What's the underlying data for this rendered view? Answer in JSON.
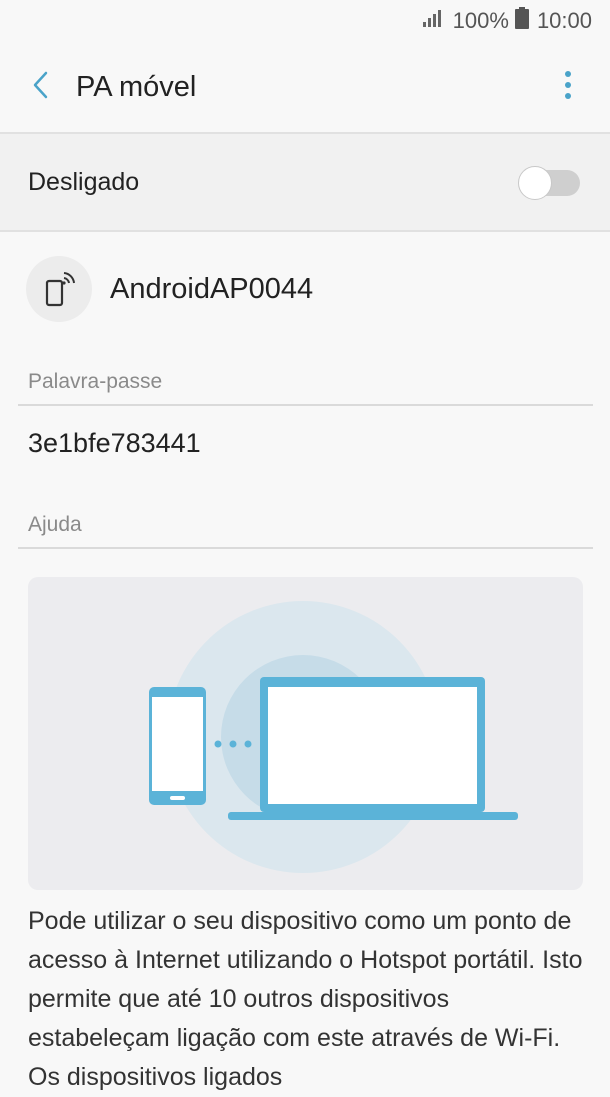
{
  "status_bar": {
    "battery": "100%",
    "time": "10:00",
    "signal_icon": "signal-bars-icon",
    "battery_icon": "battery-full-icon"
  },
  "app_bar": {
    "title": "PA móvel",
    "back_icon": "back-chevron-icon",
    "more_icon": "more-vertical-icon"
  },
  "toggle": {
    "label": "Desligado",
    "state": "off"
  },
  "network": {
    "name": "AndroidAP0044",
    "icon": "phone-hotspot-icon"
  },
  "password": {
    "header": "Palavra-passe",
    "value": "3e1bfe783441"
  },
  "help": {
    "header": "Ajuda",
    "text": "Pode utilizar o seu dispositivo como um ponto de acesso à Internet utilizando o Hotspot portátil. Isto permite que até 10 outros dispositivos estabeleçam ligação com este através de Wi-Fi. Os dispositivos ligados"
  },
  "colors": {
    "accent": "#4aa3c9",
    "illustration_blue": "#5bb3d8",
    "illustration_circle": "#d8e7ef"
  }
}
